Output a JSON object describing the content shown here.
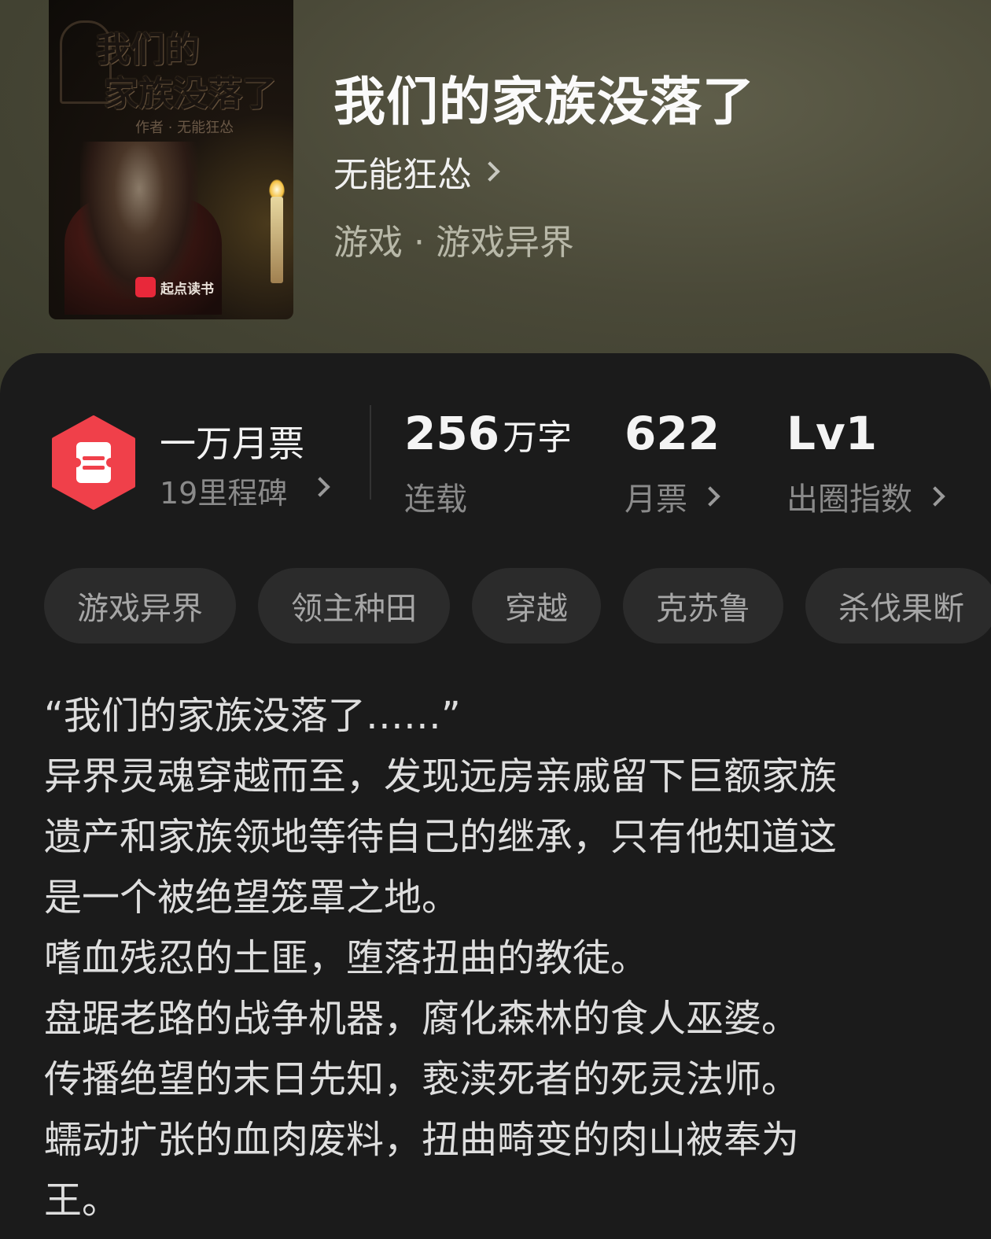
{
  "book": {
    "title": "我们的家族没落了",
    "author": "无能狂怂",
    "genre": "游戏 · 游戏异界"
  },
  "cover": {
    "title_line1": "我们的",
    "title_line2": "家族没落了",
    "author_line": "作者 · 无能狂怂",
    "brand": "起点读书"
  },
  "ticket": {
    "name": "一万月票",
    "milestone": "19里程碑",
    "badge_color": "#f0404a"
  },
  "stats": {
    "words": {
      "value": "256",
      "unit": "万字",
      "label": "连载"
    },
    "monthly": {
      "value": "622",
      "label": "月票"
    },
    "level": {
      "value": "Lv1",
      "label": "出圈指数"
    }
  },
  "tags": [
    "游戏异界",
    "领主种田",
    "穿越",
    "克苏鲁",
    "杀伐果断"
  ],
  "description": [
    "“我们的家族没落了……”",
    "异界灵魂穿越而至，发现远房亲戚留下巨额家族",
    "遗产和家族领地等待自己的继承，只有他知道这",
    "是一个被绝望笼罩之地。",
    "嗜血残忍的土匪，堕落扭曲的教徒。",
    "盘踞老路的战争机器，腐化森林的食人巫婆。",
    "传播绝望的末日先知，亵渎死者的死灵法师。",
    "蠕动扩张的血肉废料，扭曲畸变的肉山被奉为",
    "王。"
  ]
}
